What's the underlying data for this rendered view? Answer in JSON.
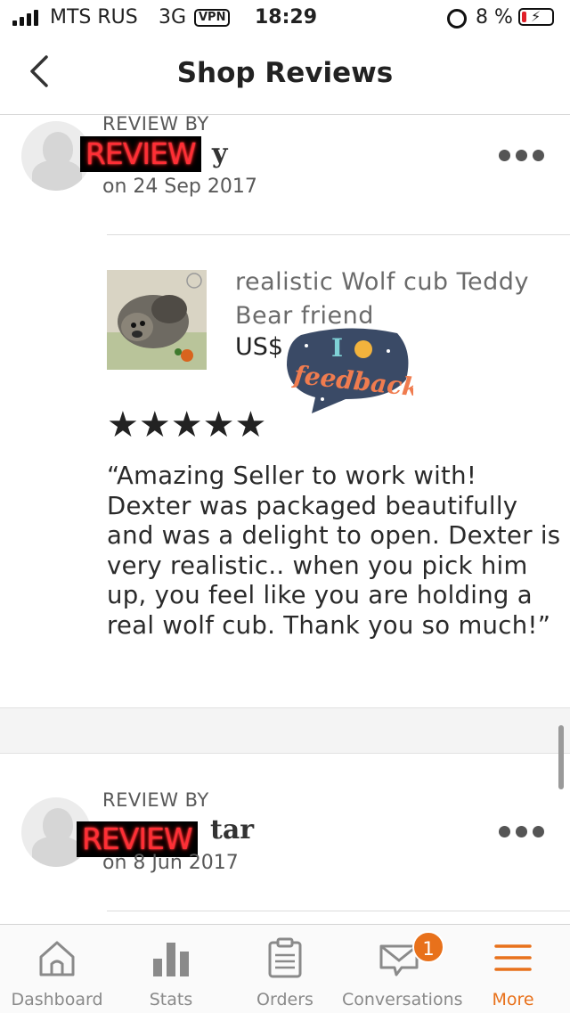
{
  "status_bar": {
    "carrier": "MTS RUS",
    "network": "3G",
    "vpn": "VPN",
    "time": "18:29",
    "battery": "8 %"
  },
  "header": {
    "title": "Shop Reviews"
  },
  "reviews": [
    {
      "review_by": "REVIEW BY",
      "name_visible": "y",
      "date": "on 24 Sep 2017",
      "overlay_text": "REVIEW",
      "product": {
        "title": "realistic Wolf cub Teddy Bear friend",
        "price": "US$"
      },
      "rating": 5,
      "stars": "★★★★★",
      "text": "“Amazing Seller to work with! Dexter was packaged beautifully and was a delight to open. Dexter is very realistic.. when you pick him up, you feel like you are holding a real wolf cub. Thank you so much!”"
    },
    {
      "review_by": "REVIEW BY",
      "name_visible": "tar",
      "date": "on 8 Jun 2017",
      "overlay_text": "REVIEW"
    }
  ],
  "sticker": {
    "text_top": "I",
    "text_main": "feedback"
  },
  "tab_bar": {
    "tabs": [
      {
        "label": "Dashboard",
        "icon": "home-icon"
      },
      {
        "label": "Stats",
        "icon": "bar-chart-icon"
      },
      {
        "label": "Orders",
        "icon": "clipboard-icon"
      },
      {
        "label": "Conversations",
        "icon": "envelope-icon"
      },
      {
        "label": "More",
        "icon": "menu-icon"
      }
    ],
    "conversations_badge": "1",
    "active": "More"
  },
  "colors": {
    "accent": "#e8711b",
    "neon": "#ff2e35",
    "sticker_bg": "#3a4a66"
  }
}
